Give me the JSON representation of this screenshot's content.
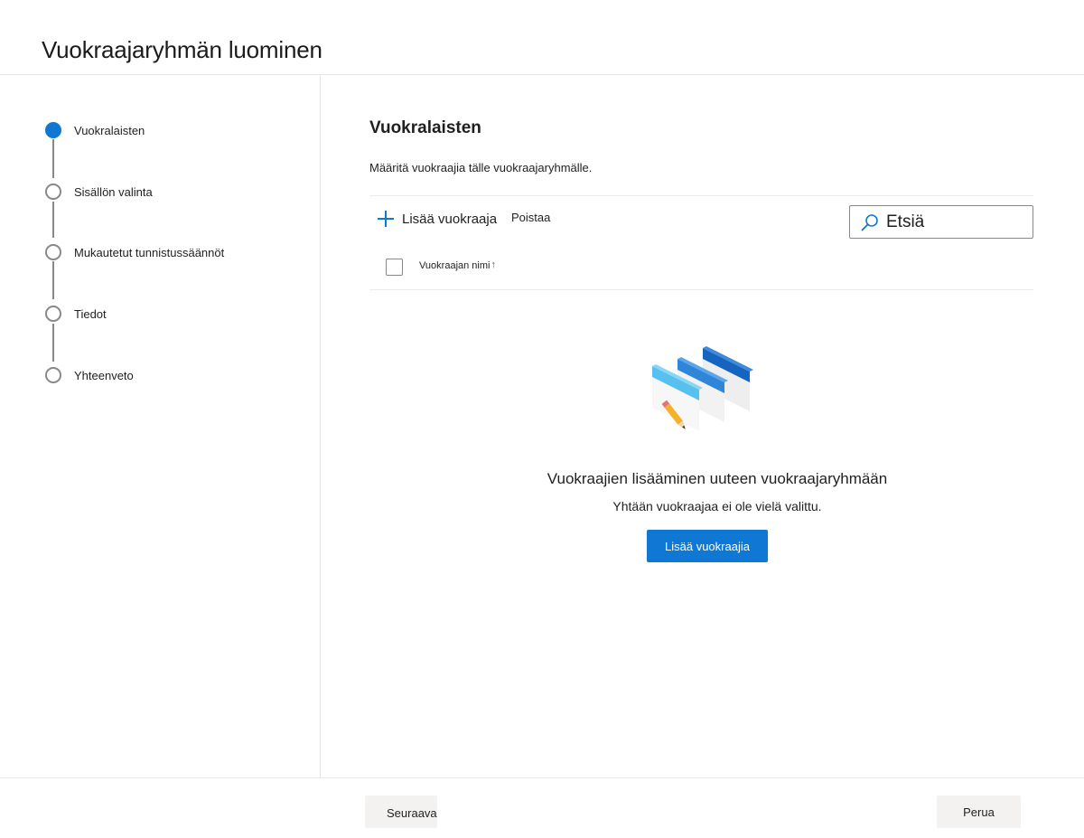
{
  "page": {
    "title": "Vuokraajaryhmän luominen"
  },
  "steps": [
    {
      "label": "Vuokralaisten",
      "state": "current"
    },
    {
      "label": "Sisällön valinta",
      "state": "pending"
    },
    {
      "label": "Mukautetut tunnistussäännöt",
      "state": "pending"
    },
    {
      "label": "Tiedot",
      "state": "pending"
    },
    {
      "label": "Yhteenveto",
      "state": "pending"
    }
  ],
  "main": {
    "heading": "Vuokralaisten",
    "description": "Määritä vuokraajia tälle vuokraajaryhmälle.",
    "toolbar": {
      "add_label": "Lisää vuokraaja",
      "remove_label": "Poistaa"
    },
    "search": {
      "placeholder": "Etsiä",
      "value": ""
    },
    "table": {
      "columns": [
        "Vuokraajan nimi"
      ],
      "sort_indicator": "↑",
      "rows": []
    },
    "empty_state": {
      "title": "Vuokraajien lisääminen uuteen vuokraajaryhmään",
      "subtitle": "Yhtään vuokraajaa ei ole vielä valittu.",
      "button_label": "Lisää vuokraajia"
    }
  },
  "footer": {
    "next_label": "Seuraava",
    "cancel_label": "Perua"
  },
  "colors": {
    "accent": "#0f78d4",
    "step_inactive": "#8a8886",
    "divider": "#e6e6e6"
  },
  "icons": [
    "plus-icon",
    "search-icon",
    "sort-up-icon",
    "empty-state-illustration"
  ]
}
